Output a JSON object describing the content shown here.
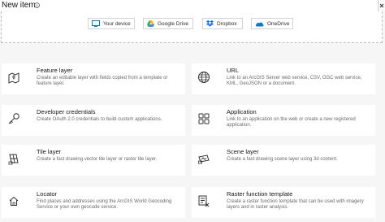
{
  "header": {
    "title": "New item"
  },
  "sources": [
    {
      "label": "Your device",
      "icon": "monitor-icon"
    },
    {
      "label": "Google Drive",
      "icon": "google-drive-icon"
    },
    {
      "label": "Dropbox",
      "icon": "dropbox-icon"
    },
    {
      "label": "OneDrive",
      "icon": "onedrive-icon"
    }
  ],
  "items": [
    {
      "title": "Feature layer",
      "description": "Create an editable layer with fields copied from a template or feature layer.",
      "icon": "feature-layer-icon"
    },
    {
      "title": "URL",
      "description": "Link to an ArcGIS Server web service, CSV, OGC web service, KML, GeoJSON or a document.",
      "icon": "globe-icon"
    },
    {
      "title": "Developer credentials",
      "description": "Create OAuth 2.0 credentials to build custom applications.",
      "icon": "key-icon"
    },
    {
      "title": "Application",
      "description": "Link to an application on the web or create a new registered application.",
      "icon": "application-grid-icon"
    },
    {
      "title": "Tile layer",
      "description": "Create a fast drawing vector tile layer or raster tile layer.",
      "icon": "tile-layer-icon"
    },
    {
      "title": "Scene layer",
      "description": "Create a fast drawing scene layer using 3d content.",
      "icon": "scene-layer-icon"
    },
    {
      "title": "Locator",
      "description": "Find places and addresses using the ArcGIS World Geocoding Service or your own geocode service.",
      "icon": "locator-icon"
    },
    {
      "title": "Raster function template",
      "description": "Create a raster function template that can be used with imagery layers and in raster analysis.",
      "icon": "raster-function-icon"
    }
  ],
  "colors": {
    "accent": "#0079c1",
    "card": "#ffffff",
    "background": "#f6f6f6"
  }
}
